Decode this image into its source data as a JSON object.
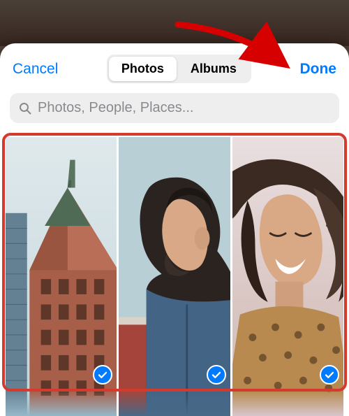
{
  "header": {
    "cancel": "Cancel",
    "done": "Done",
    "segments": {
      "photos": "Photos",
      "albums": "Albums"
    }
  },
  "search": {
    "placeholder": "Photos, People, Places..."
  },
  "annotation": {
    "arrow_target": "done-button",
    "highlight_target": "photo-grid"
  },
  "grid": {
    "tiles": [
      {
        "name": "photo-building",
        "selected": true
      },
      {
        "name": "photo-man-profile",
        "selected": true
      },
      {
        "name": "photo-woman-laughing",
        "selected": true
      }
    ]
  },
  "colors": {
    "accent": "#007aff",
    "highlight": "#d43a2e",
    "segment_bg": "#eeeeef",
    "search_bg": "#eeeeef",
    "placeholder": "#8a8a8e"
  }
}
